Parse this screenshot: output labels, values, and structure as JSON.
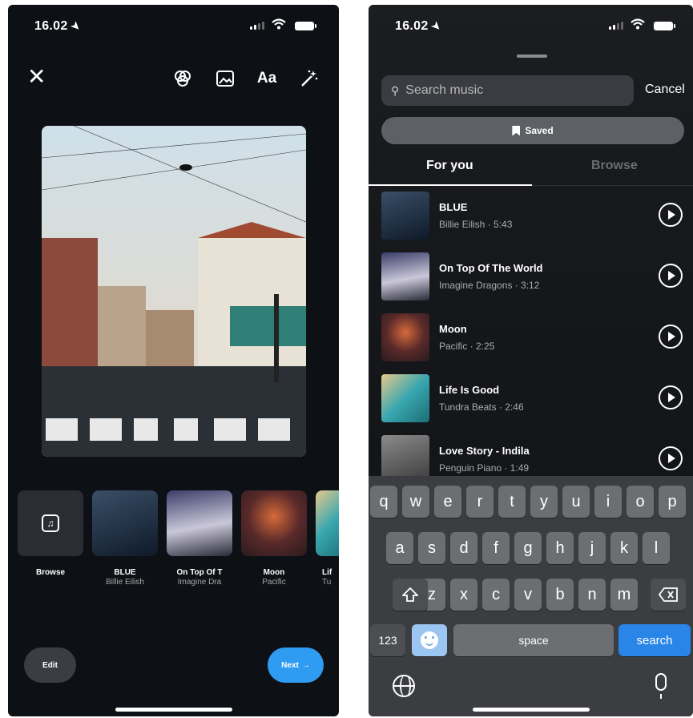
{
  "left_screen": {
    "status": {
      "time": "16.02"
    },
    "toolbar": {
      "close_icon": "close-icon",
      "tools": [
        "stickers-icon",
        "image-icon",
        "text-icon",
        "effects-icon"
      ],
      "text_label": "Aa"
    },
    "music_items": [
      {
        "title": "Browse",
        "subtitle": ""
      },
      {
        "title": "BLUE",
        "subtitle": "Billie Eilish"
      },
      {
        "title": "On Top Of T",
        "subtitle": "Imagine Dra"
      },
      {
        "title": "Moon",
        "subtitle": "Pacific"
      },
      {
        "title": "Lif",
        "subtitle": "Tu"
      }
    ],
    "edit_label": "Edit",
    "next_label": "Next"
  },
  "right_screen": {
    "status": {
      "time": "16.02"
    },
    "search": {
      "placeholder": "Search music",
      "value": ""
    },
    "cancel_label": "Cancel",
    "saved_label": "Saved",
    "tabs": [
      {
        "label": "For you",
        "active": true
      },
      {
        "label": "Browse",
        "active": false
      }
    ],
    "songs": [
      {
        "title": "BLUE",
        "meta": "Billie Eilish · 5:43"
      },
      {
        "title": "On Top Of The World",
        "meta": "Imagine Dragons · 3:12"
      },
      {
        "title": "Moon",
        "meta": "Pacific · 2:25"
      },
      {
        "title": "Life Is Good",
        "meta": "Tundra Beats · 2:46"
      },
      {
        "title": "Love Story - Indila",
        "meta": "Penguin Piano · 1:49"
      }
    ],
    "keyboard": {
      "row1": [
        "q",
        "w",
        "e",
        "r",
        "t",
        "y",
        "u",
        "i",
        "o",
        "p"
      ],
      "row2": [
        "a",
        "s",
        "d",
        "f",
        "g",
        "h",
        "j",
        "k",
        "l"
      ],
      "row3": [
        "z",
        "x",
        "c",
        "v",
        "b",
        "n",
        "m"
      ],
      "numbers_label": "123",
      "space_label": "space",
      "search_label": "search"
    }
  },
  "colors": {
    "accent_blue": "#2f9bf1",
    "search_key_blue": "#2a85e8",
    "background": "#0d1015"
  }
}
